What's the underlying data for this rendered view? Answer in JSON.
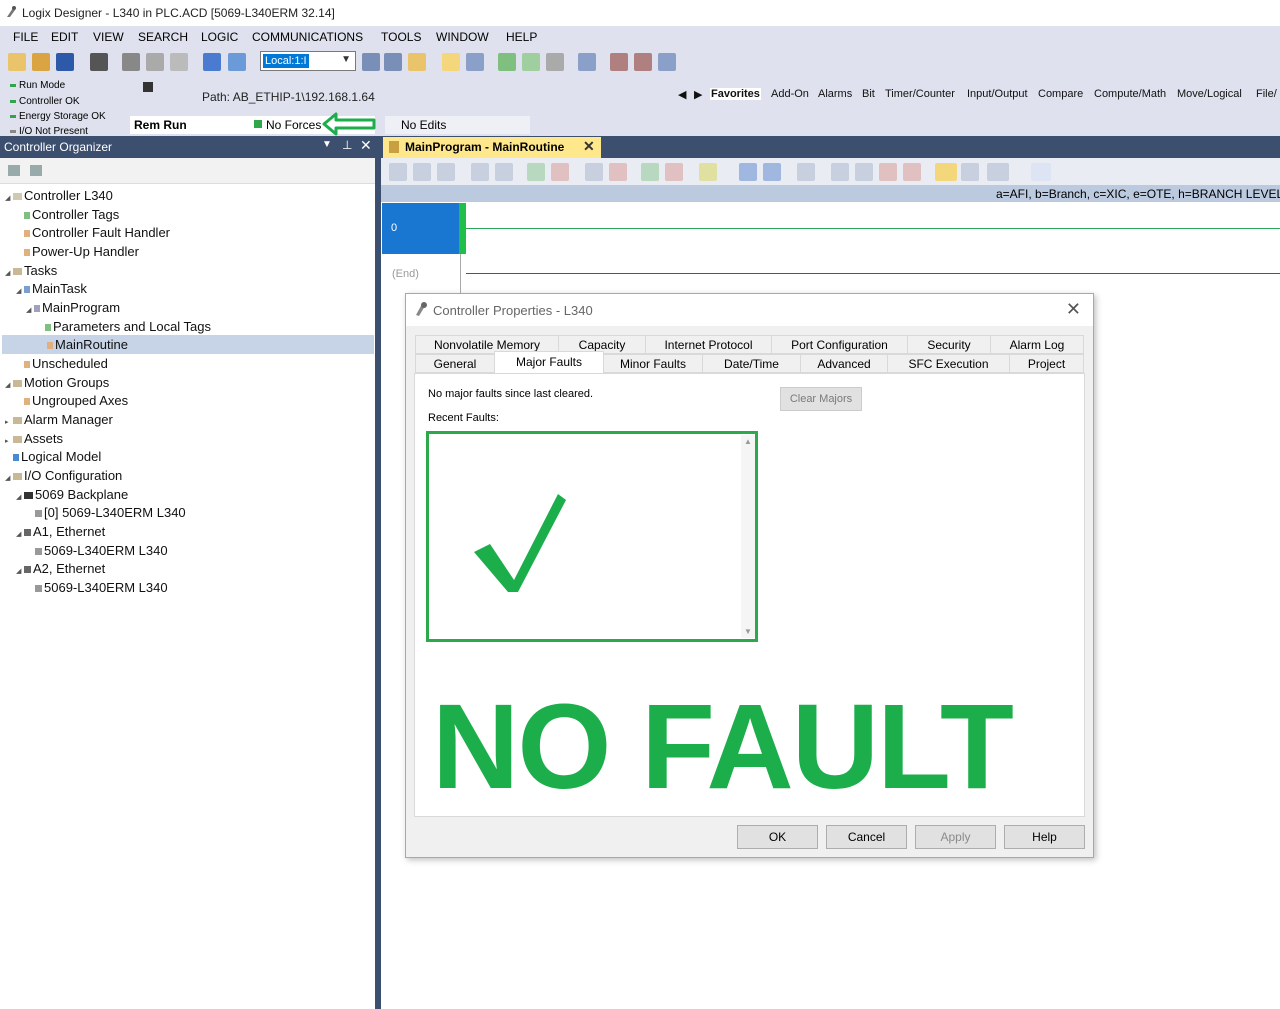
{
  "window": {
    "title": "Logix Designer - L340 in PLC.ACD [5069-L340ERM 32.14]"
  },
  "menu": [
    "FILE",
    "EDIT",
    "VIEW",
    "SEARCH",
    "LOGIC",
    "COMMUNICATIONS",
    "TOOLS",
    "WINDOW",
    "HELP"
  ],
  "toolbar": {
    "path_combo": "Local:1:I"
  },
  "status": {
    "lines": [
      "Run Mode",
      "Controller OK",
      "Energy Storage OK",
      "I/O Not Present"
    ],
    "mode": "Rem Run",
    "forces": "No Forces",
    "edits": "No Edits",
    "path": "Path:  AB_ETHIP-1\\192.168.1.64"
  },
  "instruction_tabs": [
    "Favorites",
    "Add-On",
    "Alarms",
    "Bit",
    "Timer/Counter",
    "Input/Output",
    "Compare",
    "Compute/Math",
    "Move/Logical",
    "File/"
  ],
  "organizer": {
    "title": "Controller Organizer",
    "tree": [
      "Controller L340",
      "Controller Tags",
      "Controller Fault Handler",
      "Power-Up Handler",
      "Tasks",
      "MainTask",
      "MainProgram",
      "Parameters and Local Tags",
      "MainRoutine",
      "Unscheduled",
      "Motion Groups",
      "Ungrouped Axes",
      "Alarm Manager",
      "Assets",
      "Logical Model",
      "I/O Configuration",
      "5069 Backplane",
      "[0] 5069-L340ERM L340",
      "A1, Ethernet",
      "5069-L340ERM L340",
      "A2, Ethernet",
      "5069-L340ERM L340"
    ]
  },
  "routine": {
    "tab": "MainProgram - MainRoutine",
    "legend": "a=AFI, b=Branch, c=XIC, e=OTE, h=BRANCH LEVEL, h",
    "rung": "0",
    "end": "(End)"
  },
  "dialog": {
    "title": "Controller Properties - L340",
    "tabs_row1": [
      "Nonvolatile Memory",
      "Capacity",
      "Internet Protocol",
      "Port Configuration",
      "Security",
      "Alarm Log"
    ],
    "tabs_row2": [
      "General",
      "Major Faults",
      "Minor Faults",
      "Date/Time",
      "Advanced",
      "SFC Execution",
      "Project"
    ],
    "message": "No major faults since last cleared.",
    "recent_label": "Recent Faults:",
    "clear_button": "Clear Majors",
    "overlay_text": "NO FAULT",
    "buttons": [
      "OK",
      "Cancel",
      "Apply",
      "Help"
    ]
  },
  "colors": {
    "accent_green": "#1cae4a",
    "header_blue": "#3d4f6e",
    "rung_blue": "#1977d2"
  }
}
